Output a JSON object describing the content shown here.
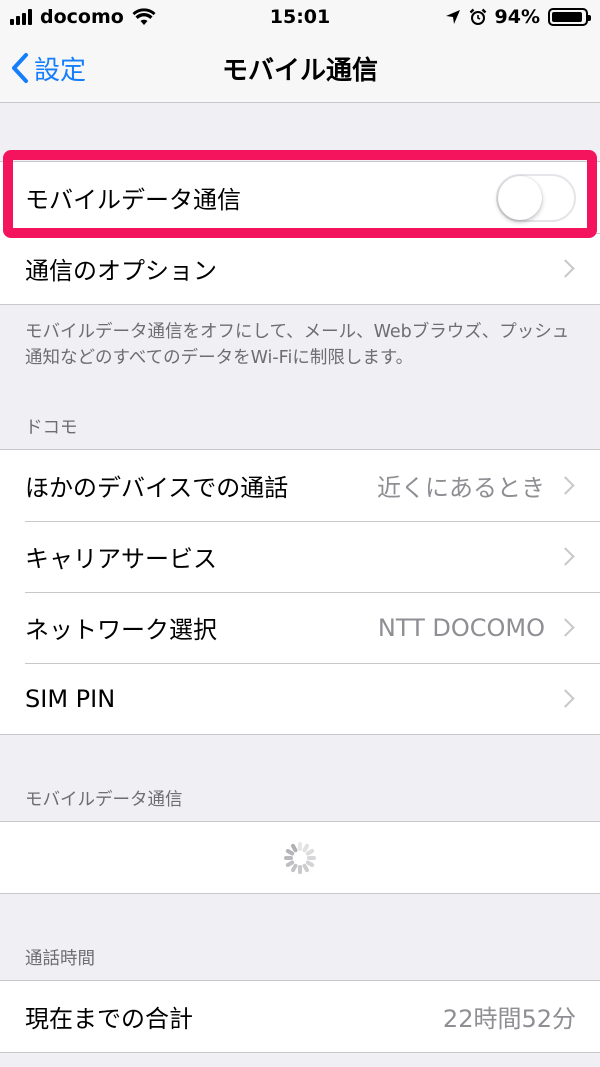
{
  "status_bar": {
    "carrier": "docomo",
    "time": "15:01",
    "battery_percent": "94%",
    "battery_level": 0.94
  },
  "nav": {
    "back_label": "設定",
    "title": "モバイル通信"
  },
  "cellular": {
    "toggle_label": "モバイルデータ通信",
    "toggle_on": false,
    "options_label": "通信のオプション",
    "footnote": "モバイルデータ通信をオフにして、メール、Webブラウズ、プッシュ通知などのすべてのデータをWi-Fiに制限します。"
  },
  "carrier_section": {
    "header": "ドコモ",
    "items": [
      {
        "label": "ほかのデバイスでの通話",
        "value": "近くにあるとき"
      },
      {
        "label": "キャリアサービス",
        "value": ""
      },
      {
        "label": "ネットワーク選択",
        "value": "NTT DOCOMO"
      },
      {
        "label": "SIM PIN",
        "value": ""
      }
    ]
  },
  "usage_section": {
    "header": "モバイルデータ通信"
  },
  "call_time_section": {
    "header": "通話時間",
    "items": [
      {
        "label": "現在までの合計",
        "value": "22時間52分"
      }
    ]
  },
  "colors": {
    "accent": "#157efb",
    "highlight": "#f4145e",
    "background": "#efeff4"
  },
  "icons": [
    "signal-bars-icon",
    "wifi-icon",
    "location-arrow-icon",
    "alarm-clock-icon",
    "battery-icon",
    "back-chevron-icon",
    "chevron-right-icon",
    "spinner-icon"
  ]
}
